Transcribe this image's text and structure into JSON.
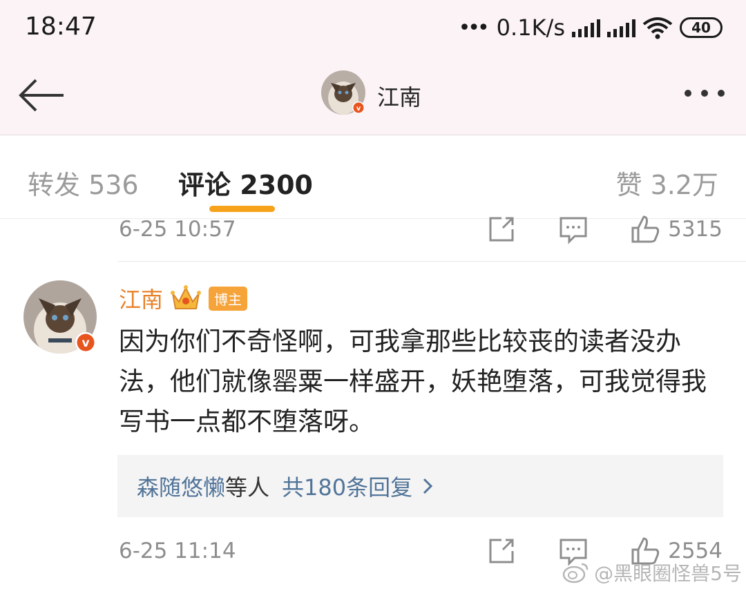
{
  "status_bar": {
    "time": "18:47",
    "net_speed": "0.1K/s",
    "battery": "40"
  },
  "header": {
    "title": "江南"
  },
  "tabs": {
    "repost": "转发 536",
    "comment": "评论 2300",
    "like": "赞 3.2万",
    "active_color": "#f7a21b"
  },
  "previous_comment": {
    "time": "6-25 10:57",
    "likes": "5315"
  },
  "comment": {
    "author": "江南",
    "badge": "博主",
    "text": "因为你们不奇怪啊，可我拿那些比较丧的读者没办法，他们就像罂粟一样盛开，妖艳堕落，可我觉得我写书一点都不堕落呀。",
    "replies": {
      "names": "森随悠懒",
      "suffix": "等人",
      "total": "共180条回复"
    },
    "time": "6-25 11:14",
    "likes": "2554"
  },
  "watermark": "@黑眼圈怪兽5号",
  "colors": {
    "name_orange": "#e8822a",
    "link_blue": "#517499",
    "header_bg": "#fbf3f6"
  }
}
